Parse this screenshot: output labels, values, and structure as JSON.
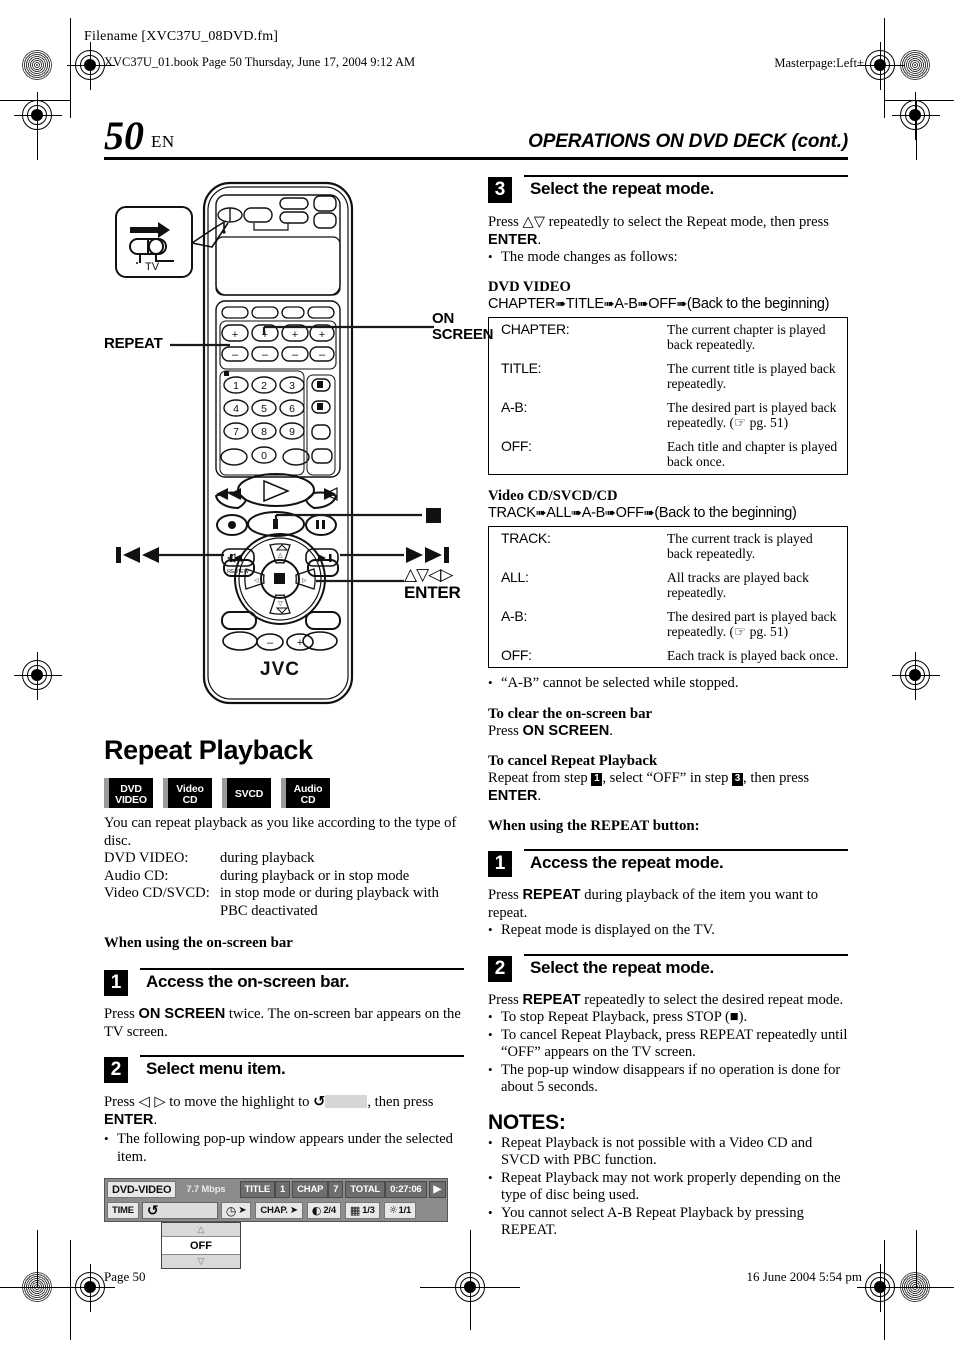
{
  "print_marks": {
    "filename_label": "Filename [XVC37U_08DVD.fm]",
    "book_line": "XVC37U_01.book  Page 50  Thursday, June 17, 2004  9:12 AM",
    "masterpage": "Masterpage:Left+"
  },
  "running_head": {
    "page_number": "50",
    "language": "EN",
    "title": "OPERATIONS ON DVD DECK (cont.)"
  },
  "remote_diagram": {
    "brand": "JVC",
    "tv_switch_label": "TV",
    "callouts": {
      "repeat": "REPEAT",
      "on_screen": "ON\nSCREEN",
      "stop": "stop-square",
      "skip_back": "skip-back",
      "skip_forward": "skip-forward",
      "arrows_enter_arrows": "arrow-cluster",
      "arrows_enter_label": "ENTER"
    },
    "keypad_digits": [
      "1",
      "2",
      "3",
      "4",
      "5",
      "6",
      "7",
      "8",
      "9",
      "0"
    ]
  },
  "left_column": {
    "section_title": "Repeat Playback",
    "disc_badges": [
      {
        "name": "dvd-video",
        "line1": "DVD",
        "line2": "VIDEO"
      },
      {
        "name": "video-cd",
        "line1": "Video",
        "line2": "CD"
      },
      {
        "name": "svcd",
        "line1": "SVCD",
        "line2": ""
      },
      {
        "name": "audio-cd",
        "line1": "Audio",
        "line2": "CD"
      }
    ],
    "intro": "You can repeat playback as you like according to the type of disc.",
    "disc_conditions": [
      {
        "label": "DVD VIDEO:",
        "value": "during playback"
      },
      {
        "label": "Audio CD:",
        "value": "during playback or in stop mode"
      },
      {
        "label": "Video CD/SVCD:",
        "value": "in stop mode or during playback with PBC deactivated"
      }
    ],
    "onscreen_heading": "When using the on-screen bar",
    "step1": {
      "number": "1",
      "title": "Access the on-screen bar.",
      "body_pre": "Press ",
      "body_bold": "ON SCREEN",
      "body_post": " twice. The on-screen bar appears on the TV screen."
    },
    "step2": {
      "number": "2",
      "title": "Select menu item.",
      "body_pre": "Press ",
      "body_arrows": "◁ ▷",
      "body_mid": " to move the highlight to ",
      "body_post": ", then press ",
      "body_bold": "ENTER",
      "body_end": ".",
      "bullet": "The following pop-up window appears under the selected item."
    }
  },
  "osd_bar": {
    "disc_type": "DVD-VIDEO",
    "bitrate": "7.7 Mbps",
    "title_label": "TITLE",
    "title_value": "1",
    "chap_label": "CHAP",
    "chap_value": "7",
    "total_label": "TOTAL",
    "total_value": "0:27:06",
    "next_arrow": "▶",
    "row2": {
      "time_label": "TIME",
      "repeat_icon": "repeat-icon",
      "clock_icon": "time-search-icon",
      "chapter_label": "CHAP.",
      "audio_value": "2/4",
      "subtitle_value": "1/3",
      "angle_value": "1/1"
    },
    "popup": {
      "up_arrow": "△",
      "value": "OFF",
      "down_arrow": "▽"
    }
  },
  "right_column": {
    "step3": {
      "number": "3",
      "title": "Select the repeat mode.",
      "body_pre": "Press ",
      "body_arrows": "△▽",
      "body_mid": " repeatedly to select the Repeat mode, then press ",
      "body_bold": "ENTER",
      "body_end": ".",
      "bullet": "The mode changes as follows:"
    },
    "dvd_video": {
      "heading": "DVD VIDEO",
      "flow": [
        "CHAPTER",
        "TITLE",
        "A-B",
        "OFF",
        "(Back to the beginning)"
      ],
      "rows": [
        {
          "key": "CHAPTER:",
          "desc": "The current chapter is played back repeatedly."
        },
        {
          "key": "TITLE:",
          "desc": "The current title is played back repeatedly."
        },
        {
          "key": "A-B:",
          "desc": "The desired part is played back repeatedly. (☞ pg. 51)"
        },
        {
          "key": "OFF:",
          "desc": "Each title and chapter is played back once."
        }
      ]
    },
    "video_cd": {
      "heading": "Video CD/SVCD/CD",
      "flow": [
        "TRACK",
        "ALL",
        "A-B",
        "OFF",
        "(Back to the beginning)"
      ],
      "rows": [
        {
          "key": "TRACK:",
          "desc": "The current track is played back repeatedly."
        },
        {
          "key": "ALL:",
          "desc": "All tracks are played back repeatedly."
        },
        {
          "key": "A-B:",
          "desc": "The desired part is played back repeatedly. (☞ pg. 51)"
        },
        {
          "key": "OFF:",
          "desc": "Each track is played back once."
        }
      ]
    },
    "ab_note": "“A-B” cannot be selected while stopped.",
    "clear_bar": {
      "heading": "To clear the on-screen bar",
      "body_pre": "Press ",
      "body_bold": "ON SCREEN",
      "body_end": "."
    },
    "cancel_repeat": {
      "heading": "To cancel Repeat Playback",
      "part1": "Repeat from step ",
      "chip1": "1",
      "part2": ", select “OFF” in step ",
      "chip2": "3",
      "part3": ", then press ",
      "bold": "ENTER",
      "part4": "."
    },
    "repeat_button_heading": "When using the REPEAT button:",
    "step_r1": {
      "number": "1",
      "title": "Access the repeat mode.",
      "body_pre": "Press ",
      "body_bold": "REPEAT",
      "body_post": " during playback of the item you want to repeat.",
      "bullet": "Repeat mode is displayed on the TV."
    },
    "step_r2": {
      "number": "2",
      "title": "Select the repeat mode.",
      "body_pre": "Press ",
      "body_bold": "REPEAT",
      "body_post": " repeatedly to select the desired repeat mode.",
      "bullets": [
        "To stop Repeat Playback, press STOP (■).",
        "To cancel Repeat Playback, press REPEAT repeatedly until “OFF” appears on the TV screen.",
        "The pop-up window disappears if no operation is done for about 5 seconds."
      ]
    },
    "notes": {
      "title": "NOTES:",
      "items": [
        "Repeat Playback is not possible with a Video CD and SVCD with PBC function.",
        "Repeat Playback may not work properly depending on the type of disc being used.",
        "You cannot select A-B Repeat Playback by pressing REPEAT."
      ]
    }
  },
  "footer": {
    "page": "Page 50",
    "date": "16 June 2004 5:54 pm"
  }
}
